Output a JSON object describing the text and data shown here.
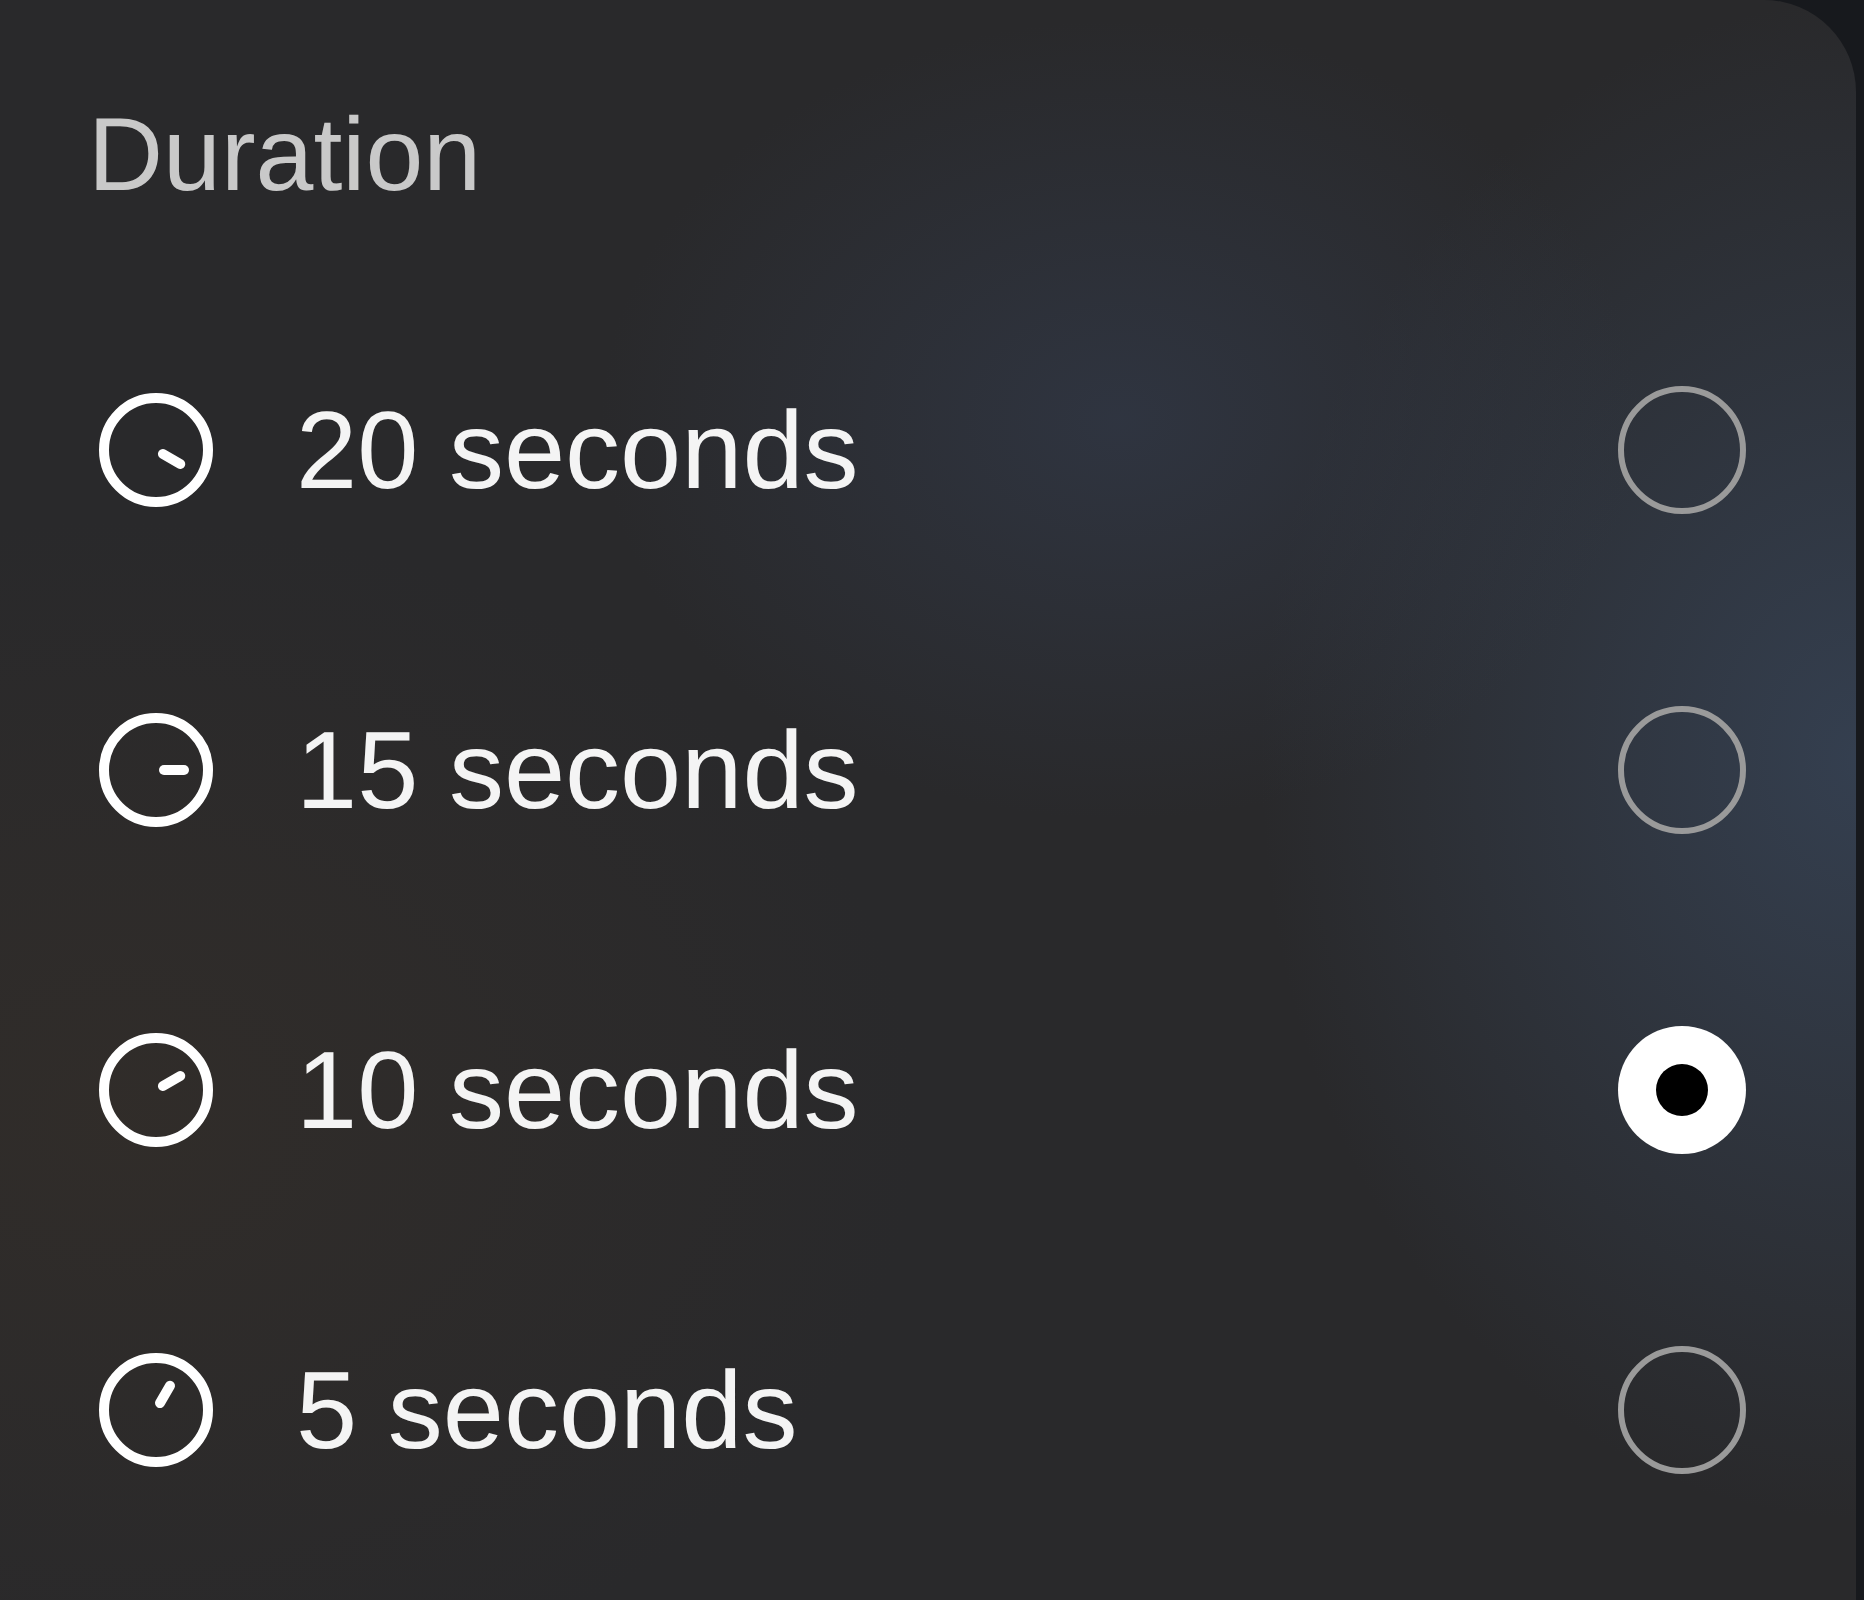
{
  "title": "Duration",
  "options": [
    {
      "label": "20 seconds",
      "selected": false
    },
    {
      "label": "15 seconds",
      "selected": false
    },
    {
      "label": "10 seconds",
      "selected": true
    },
    {
      "label": "5 seconds",
      "selected": false
    }
  ]
}
